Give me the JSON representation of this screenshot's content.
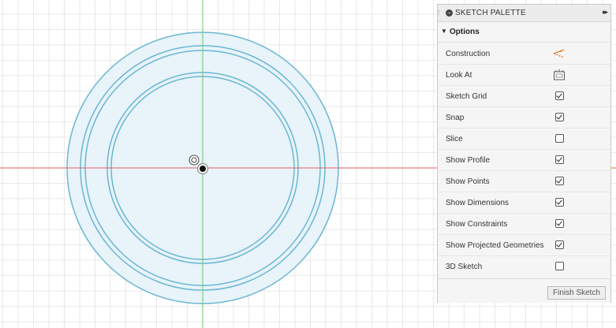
{
  "palette": {
    "title": "SKETCH PALETTE",
    "toggle_icon": "collapse-circle-icon",
    "expand_icon": "double-chevron-right-icon",
    "section_label": "Options",
    "section_caret_icon": "caret-down-icon",
    "options": [
      {
        "label": "Construction",
        "control": "icon",
        "icon": "construction-line-icon"
      },
      {
        "label": "Look At",
        "control": "icon",
        "icon": "look-at-icon"
      },
      {
        "label": "Sketch Grid",
        "control": "checkbox",
        "checked": true
      },
      {
        "label": "Snap",
        "control": "checkbox",
        "checked": true
      },
      {
        "label": "Slice",
        "control": "checkbox",
        "checked": false
      },
      {
        "label": "Show Profile",
        "control": "checkbox",
        "checked": true
      },
      {
        "label": "Show Points",
        "control": "checkbox",
        "checked": true
      },
      {
        "label": "Show Dimensions",
        "control": "checkbox",
        "checked": true
      },
      {
        "label": "Show Constraints",
        "control": "checkbox",
        "checked": true
      },
      {
        "label": "Show Projected Geometries",
        "control": "checkbox",
        "checked": true
      },
      {
        "label": "3D Sketch",
        "control": "checkbox",
        "checked": false
      }
    ],
    "finish_button_label": "Finish Sketch"
  },
  "canvas": {
    "grid_color": "#e3e3e3",
    "x_axis_color": "#e0605a",
    "y_axis_color": "#6cc46c",
    "circle_stroke_color": "#6ab7d3",
    "circle_fill_color": "#e8f3fa",
    "circle_count": 4,
    "origin_marker": "origin-point-icon"
  },
  "colors": {
    "construction_icon": "#d86a1e",
    "panel_background": "#f5f5f5"
  }
}
